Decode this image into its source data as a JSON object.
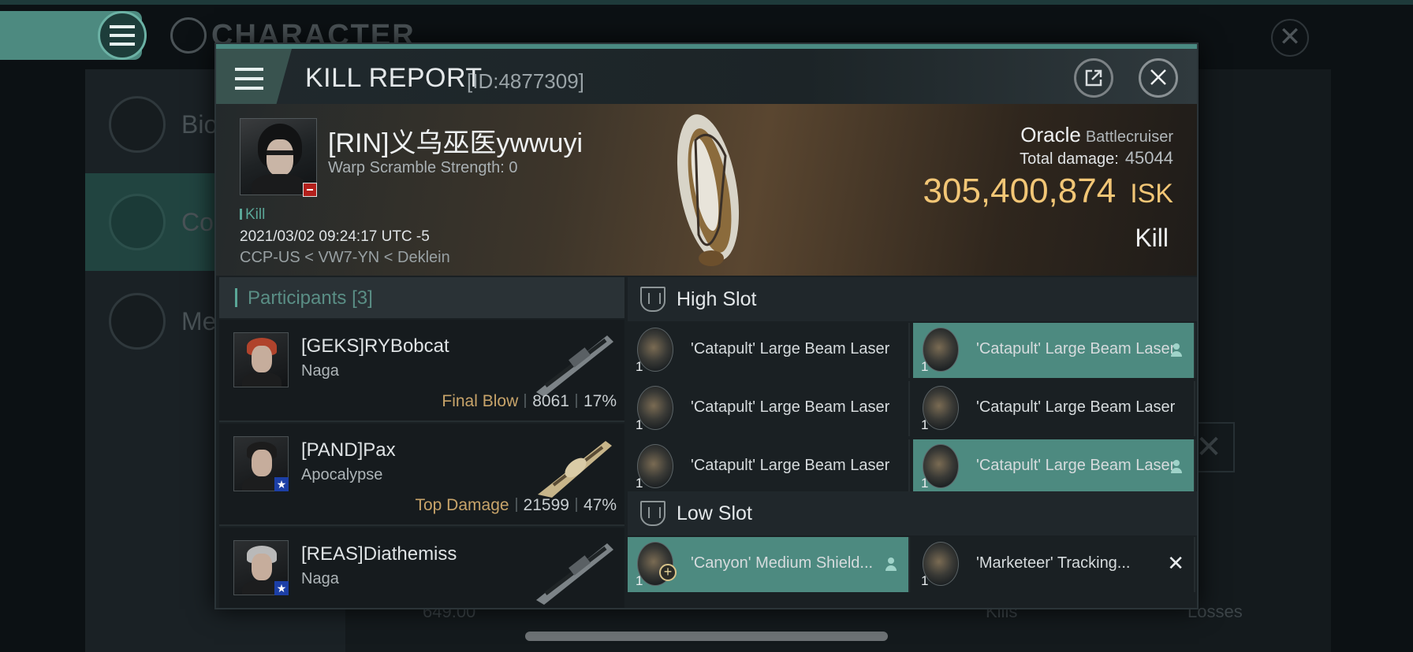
{
  "background": {
    "title": "CHARACTER",
    "sidebar": [
      "Bio",
      "Co",
      "Me"
    ],
    "stat_value": "649.00",
    "kills_label": "Kills",
    "losses_label": "Losses"
  },
  "dialog": {
    "title": "KILL REPORT",
    "id_text": "[ID:4877309]"
  },
  "victim": {
    "name": "[RIN]义乌巫医ywwuyi",
    "warp_scramble": "Warp Scramble Strength: 0",
    "kill_tag": "Kill",
    "datetime": "2021/03/02 09:24:17 UTC -5",
    "location": "CCP-US < VW7-YN < Deklein",
    "ship_name": "Oracle",
    "ship_class": "Battlecruiser",
    "total_damage_label": "Total damage:",
    "total_damage": "45044",
    "isk_value": "305,400,874",
    "isk_unit": "ISK",
    "result": "Kill"
  },
  "participants": {
    "label": "Participants",
    "count": "[3]",
    "list": [
      {
        "name": "[GEKS]RYBobcat",
        "ship": "Naga",
        "role": "Final Blow",
        "damage": "8061",
        "percent": "17%",
        "hair": "#b0432c",
        "weapon": "railgun-icon"
      },
      {
        "name": "[PAND]Pax",
        "ship": "Apocalypse",
        "role": "Top Damage",
        "damage": "21599",
        "percent": "47%",
        "hair": "#1c1c1c",
        "weapon": "laser-icon"
      },
      {
        "name": "[REAS]Diathemiss",
        "ship": "Naga",
        "role": "",
        "damage": "",
        "percent": "",
        "hair": "#b9b9b9",
        "weapon": "railgun-icon"
      }
    ]
  },
  "slots": {
    "high": {
      "label": "High Slot",
      "modules": [
        {
          "qty": "1",
          "name": "'Catapult' Large Beam Laser",
          "highlight": false
        },
        {
          "qty": "1",
          "name": "'Catapult' Large Beam Laser",
          "highlight": true
        },
        {
          "qty": "1",
          "name": "'Catapult' Large Beam Laser",
          "highlight": false
        },
        {
          "qty": "1",
          "name": "'Catapult' Large Beam Laser",
          "highlight": false
        },
        {
          "qty": "1",
          "name": "'Catapult' Large Beam Laser",
          "highlight": false
        },
        {
          "qty": "1",
          "name": "'Catapult' Large Beam Laser",
          "highlight": true
        }
      ]
    },
    "low": {
      "label": "Low Slot",
      "modules": [
        {
          "qty": "1",
          "name": "'Canyon' Medium Shield...",
          "highlight": true
        },
        {
          "qty": "1",
          "name": "'Marketeer' Tracking...",
          "highlight": false
        }
      ]
    }
  }
}
